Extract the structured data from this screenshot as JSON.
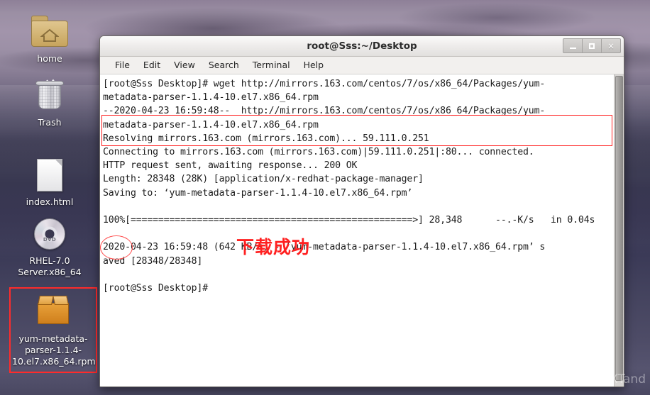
{
  "desktop": {
    "icons": [
      {
        "name": "home",
        "label": "home",
        "icon": "folder-home-icon"
      },
      {
        "name": "trash",
        "label": "Trash",
        "icon": "trash-icon"
      },
      {
        "name": "index-html",
        "label": "index.html",
        "icon": "html-document-icon"
      },
      {
        "name": "rhel-dvd",
        "label": "RHEL-7.0 Server.x86_64",
        "icon": "dvd-disc-icon",
        "dvd_text": "DVD"
      },
      {
        "name": "rpm-package",
        "label": "yum-metadata-parser-1.1.4-10.el7.x86_64.rpm",
        "icon": "package-box-icon",
        "selected": true
      }
    ]
  },
  "window": {
    "title": "root@Sss:~/Desktop",
    "buttons": {
      "minimize": "minimize-button",
      "maximize": "maximize-button",
      "close": "×"
    },
    "menu": [
      "File",
      "Edit",
      "View",
      "Search",
      "Terminal",
      "Help"
    ]
  },
  "terminal": {
    "content": "[root@Sss Desktop]# wget http://mirrors.163.com/centos/7/os/x86_64/Packages/yum-\nmetadata-parser-1.1.4-10.el7.x86_64.rpm\n--2020-04-23 16:59:48--  http://mirrors.163.com/centos/7/os/x86_64/Packages/yum-\nmetadata-parser-1.1.4-10.el7.x86_64.rpm\nResolving mirrors.163.com (mirrors.163.com)... 59.111.0.251\nConnecting to mirrors.163.com (mirrors.163.com)|59.111.0.251|:80... connected.\nHTTP request sent, awaiting response... 200 OK\nLength: 28348 (28K) [application/x-redhat-package-manager]\nSaving to: ‘yum-metadata-parser-1.1.4-10.el7.x86_64.rpm’\n\n100%[===================================================>] 28,348      --.-K/s   in 0.04s\n\n2020-04-23 16:59:48 (642 KB/s) - ‘yum-metadata-parser-1.1.4-10.el7.x86_64.rpm’ s\naved [28348/28348]\n\n[root@Sss Desktop]# ",
    "command": "wget http://mirrors.163.com/centos/7/os/x86_64/Packages/yum-metadata-parser-1.1.4-10.el7.x86_64.rpm",
    "prompt": "[root@Sss Desktop]#",
    "download": {
      "percent": "100%",
      "bytes": "28,348",
      "rate": "--.-K/s",
      "time": "in 0.04s",
      "speed": "642 KB/s",
      "saved": "[28348/28348]",
      "length": "28348 (28K)",
      "content_type": "application/x-redhat-package-manager",
      "host": "mirrors.163.com",
      "ip": "59.111.0.251",
      "status": "200 OK",
      "timestamp": "2020-04-23 16:59:48",
      "filename": "yum-metadata-parser-1.1.4-10.el7.x86_64.rpm"
    }
  },
  "annotations": {
    "chinese_note": "下载成功",
    "highlight_color": "#ff2020"
  },
  "watermark": "https://blog.csdn.net/XTand"
}
